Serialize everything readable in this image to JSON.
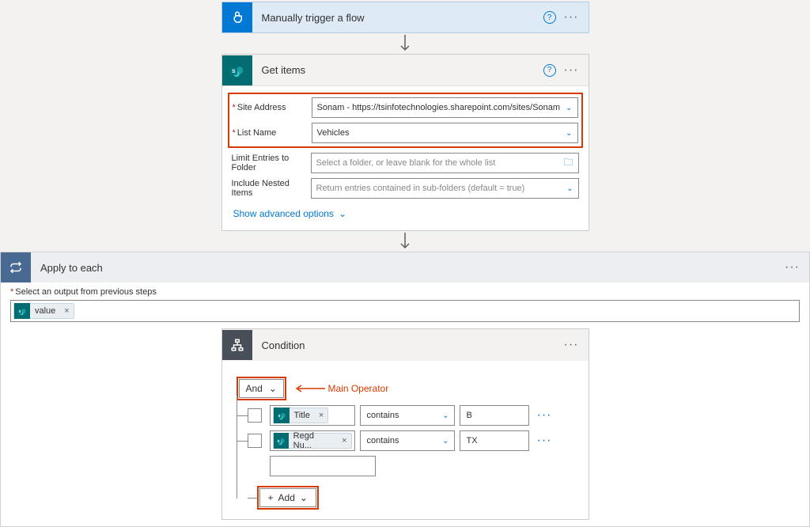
{
  "trigger": {
    "title": "Manually trigger a flow"
  },
  "getItems": {
    "title": "Get items",
    "siteAddressLabel": "Site Address",
    "siteAddressValue": "Sonam - https://tsinfotechnologies.sharepoint.com/sites/Sonam",
    "listNameLabel": "List Name",
    "listNameValue": "Vehicles",
    "limitLabel": "Limit Entries to Folder",
    "limitPlaceholder": "Select a folder, or leave blank for the whole list",
    "nestedLabel": "Include Nested Items",
    "nestedPlaceholder": "Return entries contained in sub-folders (default = true)",
    "advLink": "Show advanced options"
  },
  "applyEach": {
    "title": "Apply to each",
    "selectLabel": "Select an output from previous steps",
    "tokenText": "value"
  },
  "condition": {
    "title": "Condition",
    "mainOperator": "And",
    "mainOperatorAnnotation": "Main Operator",
    "addLabel": "Add",
    "rows": [
      {
        "field": "Title",
        "operator": "contains",
        "value": "B"
      },
      {
        "field": "Regd Nu...",
        "operator": "contains",
        "value": "TX"
      }
    ]
  }
}
